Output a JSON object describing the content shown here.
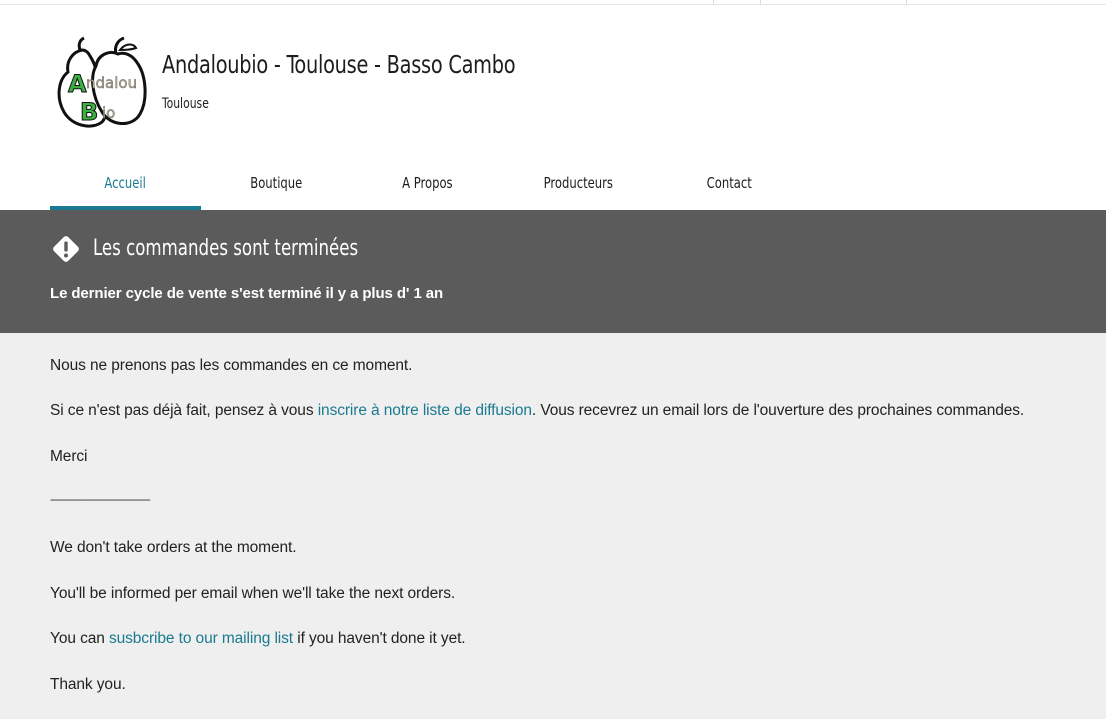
{
  "header": {
    "shop_name": "Andaloubio - Toulouse - Basso Cambo",
    "city": "Toulouse",
    "logo_text": "AndalouBio"
  },
  "nav": {
    "items": [
      "Accueil",
      "Boutique",
      "A Propos",
      "Producteurs",
      "Contact"
    ],
    "active": "Accueil"
  },
  "banner": {
    "icon": "warning-diamond-icon",
    "title": "Les commandes sont terminées",
    "subtitle": "Le dernier cycle de vente s'est terminé il y a plus d' 1 an"
  },
  "content": {
    "p1": "Nous ne prenons pas les commandes en ce moment.",
    "p2_before": "Si ce n'est pas déjà fait, pensez à vous ",
    "p2_link": "inscrire à notre liste de diffusion",
    "p2_after": ". Vous recevrez un email lors de l'ouverture des prochaines commandes.",
    "p3": "Merci",
    "separator": "------------------------------------------------",
    "p4": "We don't take orders at the moment.",
    "p5": "You'll be informed per email when we'll take the next orders.",
    "p6_before": "You can ",
    "p6_link": "susbcribe to our mailing list",
    "p6_after": " if you haven't done it yet.",
    "p7": "Thank you."
  },
  "colors": {
    "accent": "#1a7a90",
    "banner_bg": "#5b5b5b",
    "content_bg": "#efefef",
    "logo_green": "#3cb043"
  }
}
